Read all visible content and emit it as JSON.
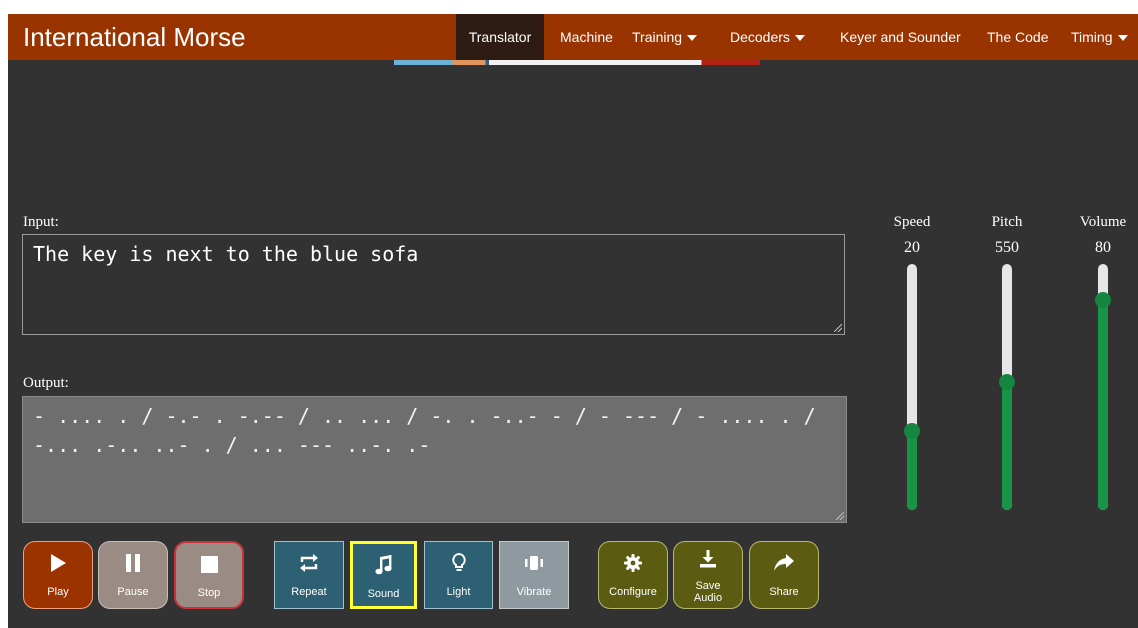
{
  "app": {
    "title": "International Morse"
  },
  "nav": [
    {
      "label": "Translator",
      "active": true,
      "dropdown": false
    },
    {
      "label": "Machine",
      "active": false,
      "dropdown": false
    },
    {
      "label": "Training",
      "active": false,
      "dropdown": true
    },
    {
      "label": "Decoders",
      "active": false,
      "dropdown": true
    },
    {
      "label": "Keyer and Sounder",
      "active": false,
      "dropdown": false
    },
    {
      "label": "The Code",
      "active": false,
      "dropdown": false
    },
    {
      "label": "Timing",
      "active": false,
      "dropdown": true
    }
  ],
  "input": {
    "label": "Input:",
    "value": "The key is next to the blue sofa"
  },
  "output": {
    "label": "Output:",
    "value": "- .... . / -.- . -.-- / .. ... / -. . -..- - / - --- / - .... . / -... .-.. ..- . / ... --- ..-. .-"
  },
  "sliders": [
    {
      "label": "Speed",
      "value": "20",
      "level": 0.31
    },
    {
      "label": "Pitch",
      "value": "550",
      "level": 0.52
    },
    {
      "label": "Volume",
      "value": "80",
      "level": 0.88
    }
  ],
  "buttons": {
    "play": "Play",
    "pause": "Pause",
    "stop": "Stop",
    "repeat": "Repeat",
    "sound": "Sound",
    "light": "Light",
    "vibrate": "Vibrate",
    "configure": "Configure",
    "save_audio_line1": "Save",
    "save_audio_line2": "Audio",
    "share": "Share"
  },
  "colors": {
    "navbar": "#993300",
    "active_tab": "#2e1c14",
    "background": "#323232",
    "slider_fill": "#179446",
    "sound_highlight": "#ffff33"
  },
  "icons": {
    "play": "play-icon",
    "pause": "pause-icon",
    "stop": "stop-icon",
    "repeat": "repeat-icon",
    "sound": "music-note-icon",
    "light": "lightbulb-icon",
    "vibrate": "vibrate-icon",
    "configure": "gear-icon",
    "save": "download-icon",
    "share": "share-arrow-icon"
  }
}
